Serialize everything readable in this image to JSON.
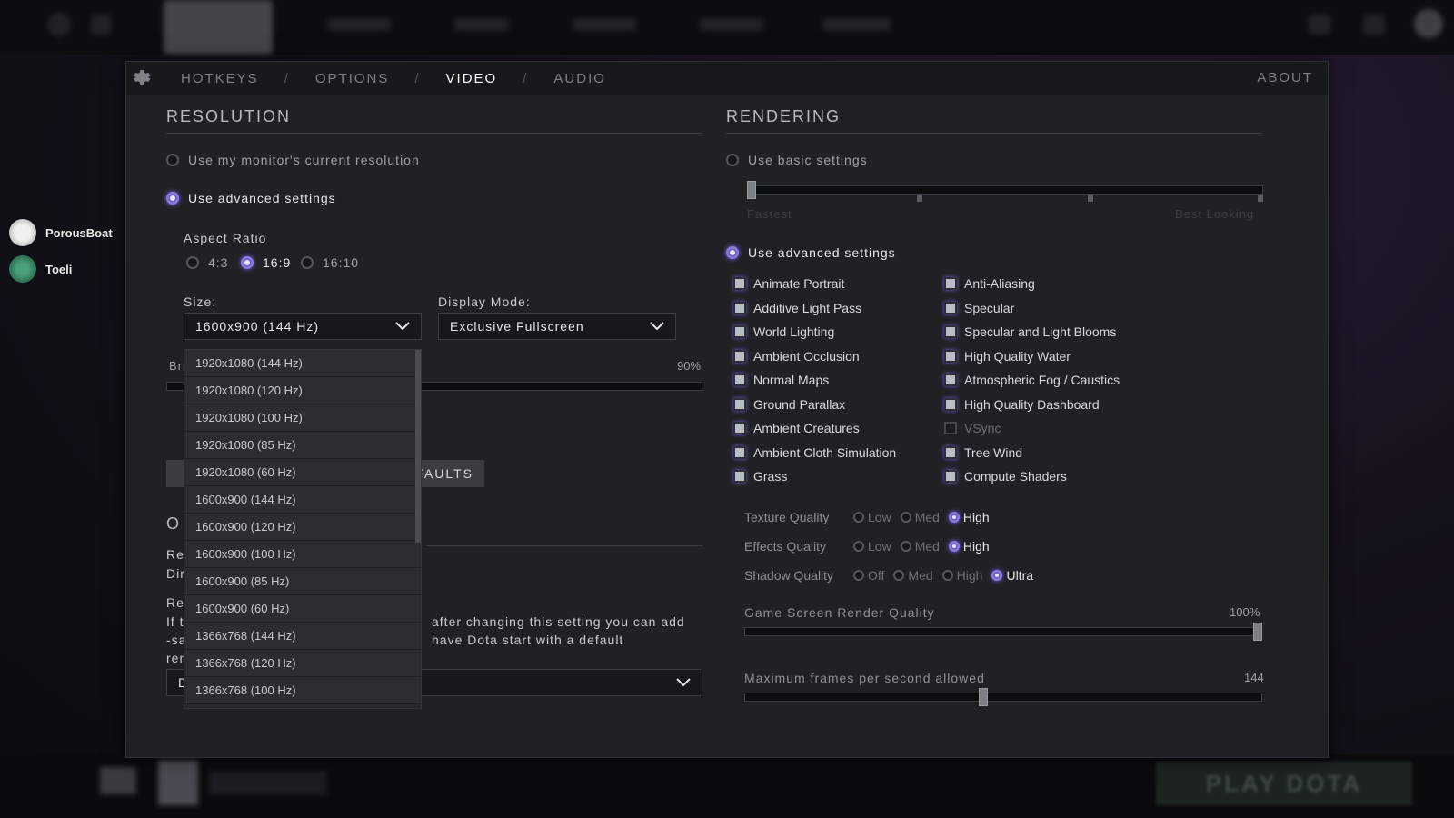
{
  "friends": [
    {
      "name": "PorousBoat",
      "color": "#d8d8d8"
    },
    {
      "name": "Toeli",
      "color": "#2f7a5a"
    }
  ],
  "bottom": {
    "play_label": "PLAY DOTA"
  },
  "tabs": [
    {
      "label": "HOTKEYS",
      "active": false
    },
    {
      "label": "OPTIONS",
      "active": false
    },
    {
      "label": "VIDEO",
      "active": true
    },
    {
      "label": "AUDIO",
      "active": false
    }
  ],
  "separator": "/",
  "about_label": "ABOUT",
  "resolution": {
    "title": "RESOLUTION",
    "use_monitor": "Use my monitor's current resolution",
    "use_advanced": "Use advanced settings",
    "aspect_label": "Aspect Ratio",
    "aspect_options": [
      "4:3",
      "16:9",
      "16:10"
    ],
    "aspect_selected": "16:9",
    "size_label": "Size:",
    "size_value": "1600x900 (144 Hz)",
    "display_mode_label": "Display Mode:",
    "display_mode_value": "Exclusive Fullscreen",
    "brightness_partial": "Bri",
    "brightness_value": "90%",
    "brightness_level": 0.9,
    "defaults_partial": "FAULTS",
    "size_options": [
      "1920x1080 (144 Hz)",
      "1920x1080 (120 Hz)",
      "1920x1080 (100 Hz)",
      "1920x1080 (85 Hz)",
      "1920x1080 (60 Hz)",
      "1600x900 (144 Hz)",
      "1600x900 (120 Hz)",
      "1600x900 (100 Hz)",
      "1600x900 (85 Hz)",
      "1600x900 (60 Hz)",
      "1366x768 (144 Hz)",
      "1366x768 (120 Hz)",
      "1366x768 (100 Hz)"
    ]
  },
  "other": {
    "title_partial": "O",
    "line1_partial": "Re",
    "line2_partial": "Dir",
    "line3_partial": "Re",
    "text1_left": "If t",
    "text2_left": "-sa",
    "text3_left": "ren",
    "text1_right": "after changing this setting you can add",
    "text2_right": "have Dota start with a default",
    "dropdown_partial": "D"
  },
  "rendering": {
    "title": "RENDERING",
    "use_basic": "Use basic settings",
    "basic_left": "Fastest",
    "basic_right": "Best Looking",
    "use_advanced": "Use advanced settings",
    "left_checks": [
      {
        "label": "Animate Portrait",
        "checked": true
      },
      {
        "label": "Additive Light Pass",
        "checked": true
      },
      {
        "label": "World Lighting",
        "checked": true
      },
      {
        "label": "Ambient Occlusion",
        "checked": true
      },
      {
        "label": "Normal Maps",
        "checked": true
      },
      {
        "label": "Ground Parallax",
        "checked": true
      },
      {
        "label": "Ambient Creatures",
        "checked": true
      },
      {
        "label": "Ambient Cloth Simulation",
        "checked": true
      },
      {
        "label": "Grass",
        "checked": true
      }
    ],
    "right_checks": [
      {
        "label": "Anti-Aliasing",
        "checked": true
      },
      {
        "label": "Specular",
        "checked": true
      },
      {
        "label": "Specular and Light Blooms",
        "checked": true
      },
      {
        "label": "High Quality Water",
        "checked": true
      },
      {
        "label": "Atmospheric Fog / Caustics",
        "checked": true
      },
      {
        "label": "High Quality Dashboard",
        "checked": true
      },
      {
        "label": "VSync",
        "checked": false
      },
      {
        "label": "Tree Wind",
        "checked": true
      },
      {
        "label": "Compute Shaders",
        "checked": true
      }
    ],
    "texture": {
      "label": "Texture Quality",
      "options": [
        "Low",
        "Med",
        "High"
      ],
      "selected": "High"
    },
    "effects": {
      "label": "Effects Quality",
      "options": [
        "Low",
        "Med",
        "High"
      ],
      "selected": "High"
    },
    "shadow": {
      "label": "Shadow Quality",
      "options": [
        "Off",
        "Med",
        "High",
        "Ultra"
      ],
      "selected": "Ultra"
    },
    "render_quality_label": "Game Screen Render Quality",
    "render_quality_value": "100%",
    "render_quality_level": 1.0,
    "max_fps_label": "Maximum frames per second allowed",
    "max_fps_value": "144",
    "max_fps_level": 0.46
  },
  "colors": {
    "accent": "#8a7bd6",
    "panel": "#1f2124",
    "text": "#c8ccd0"
  }
}
